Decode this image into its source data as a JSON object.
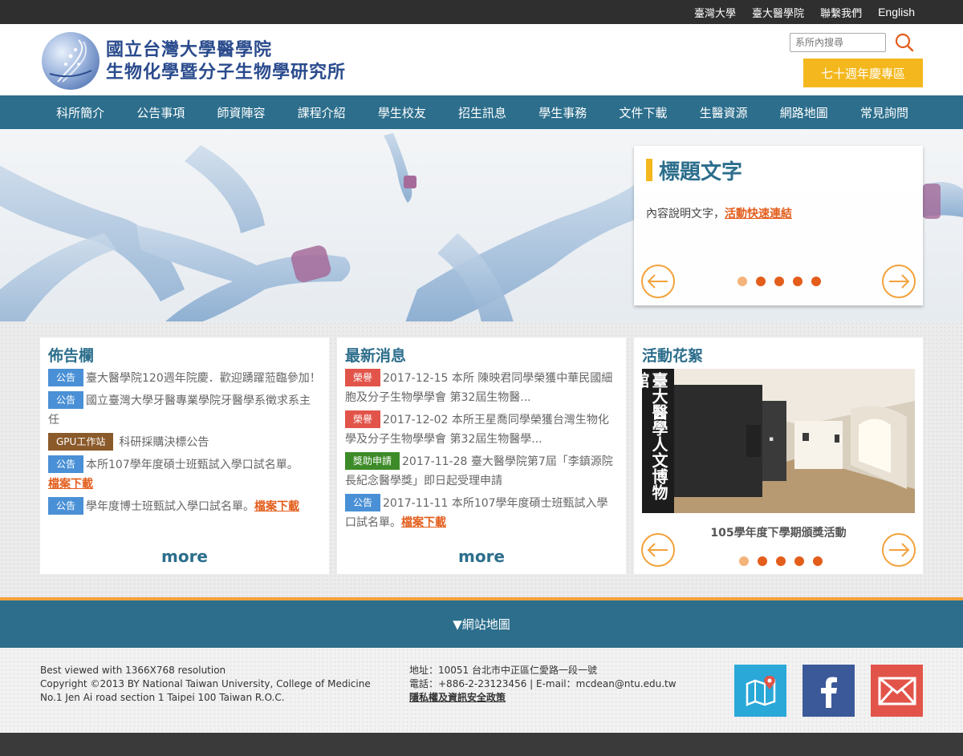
{
  "topbar": {
    "links": [
      "臺灣大學",
      "臺大醫學院",
      "聯繫我們",
      "English"
    ]
  },
  "header": {
    "logo_line1": "國立台灣大學醫學院",
    "logo_line2": "生物化學暨分子生物學研究所",
    "search_placeholder": "系所內搜尋",
    "anniversary_label": "七十週年慶專區"
  },
  "nav": {
    "items": [
      "科所簡介",
      "公告事項",
      "師資陣容",
      "課程介紹",
      "學生校友",
      "招生訊息",
      "學生事務",
      "文件下載",
      "生醫資源",
      "網路地圖",
      "常見詢問"
    ]
  },
  "banner": {
    "title": "標題文字",
    "body": "內容說明文字，",
    "link": "活動快速連結",
    "slide_count": 5,
    "active_slide": 1
  },
  "bulletin": {
    "title": "佈告欄",
    "items": [
      {
        "tag": "公告",
        "text": "臺大醫學院120週年院慶．歡迎踴躍蒞臨參加！",
        "link": ""
      },
      {
        "tag": "公告",
        "text": "國立臺灣大學牙醫專業學院牙醫學系徵求系主任",
        "link": ""
      },
      {
        "tag": "GPU工作站",
        "text": "科研採購決標公告",
        "link": ""
      },
      {
        "tag": "公告",
        "text": "本所107學年度碩士班甄試入學口試名單。",
        "link": "檔案下載"
      },
      {
        "tag": "公告",
        "text": "學年度博士班甄試入學口試名單。",
        "link": "檔案下載"
      }
    ],
    "more": "more"
  },
  "news": {
    "title": "最新消息",
    "items": [
      {
        "tag": "榮譽",
        "text": "2017-12-15 本所 陳映君同學榮獲中華民國細胞及分子生物學學會 第32屆生物醫...",
        "link": ""
      },
      {
        "tag": "榮譽",
        "text": "2017-12-02 本所王星喬同學榮獲台灣生物化學及分子生物學學會 第32屆生物醫學...",
        "link": ""
      },
      {
        "tag": "獎助申請",
        "text": "2017-11-28 臺大醫學院第7屆「李鎮源院長紀念醫學獎」即日起受理申請",
        "link": ""
      },
      {
        "tag": "公告",
        "text": "2017-11-11 本所107學年度碩士班甄試入學口試名單。",
        "link": "檔案下載"
      }
    ],
    "more": "more"
  },
  "gallery": {
    "title": "活動花絮",
    "caption": "105學年度下學期頒獎活動",
    "photo_sign": "臺大醫學人文博物館",
    "slide_count": 5,
    "active_slide": 1
  },
  "sitemap": {
    "label": "▼網站地圖"
  },
  "footer": {
    "left_lines": [
      "Best viewed with 1366X768 resolution",
      "Copyright ©2013 BY National Taiwan University, College of Medicine",
      "No.1 Jen Ai road section 1 Taipei 100 Taiwan R.O.C."
    ],
    "address": "地址：10051 台北市中正區仁愛路一段一號",
    "contact": "電話：+886-2-23123456 | E-mail：mcdean@ntu.edu.tw",
    "privacy": "隱私權及資訊安全政策",
    "social": [
      "map-icon",
      "facebook-icon",
      "email-icon"
    ]
  },
  "colors": {
    "primary": "#2c6e8c",
    "accent": "#f4b81e",
    "link": "#e35d1b",
    "topbar": "#2f2f2f"
  }
}
